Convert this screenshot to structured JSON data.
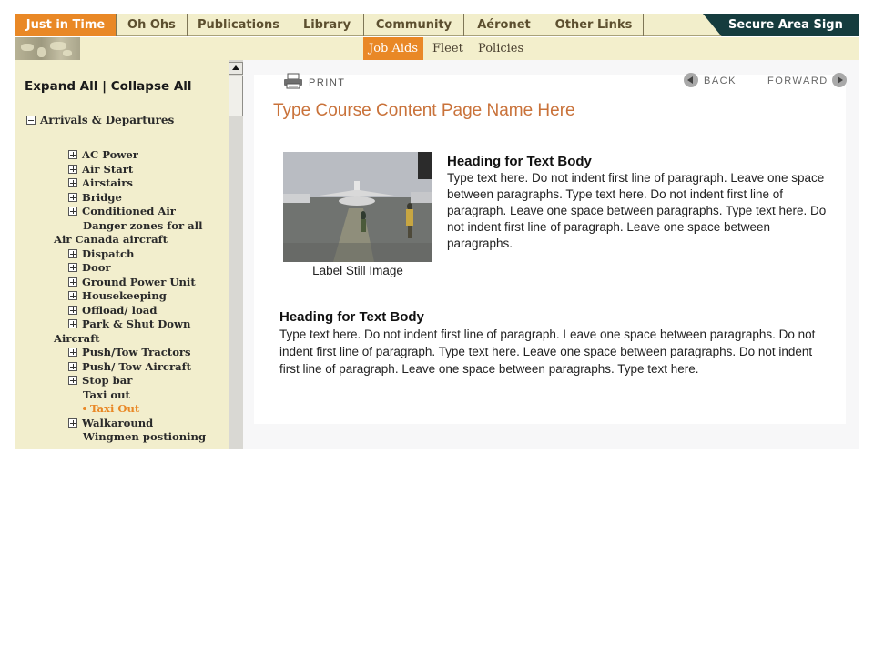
{
  "top_nav": {
    "tabs": [
      {
        "label": "Just in Time",
        "active": true
      },
      {
        "label": "Oh Ohs",
        "active": false
      },
      {
        "label": "Publications",
        "active": false
      },
      {
        "label": "Library",
        "active": false
      },
      {
        "label": "Community",
        "active": false
      },
      {
        "label": "Aéronet",
        "active": false
      },
      {
        "label": "Other Links",
        "active": false
      }
    ],
    "secure_sign_in": "Secure Area Sign In"
  },
  "sub_nav": {
    "tabs": [
      {
        "label": "Job Aids",
        "active": true
      },
      {
        "label": "Fleet",
        "active": false
      },
      {
        "label": "Policies",
        "active": false
      }
    ]
  },
  "sidebar": {
    "expand_all": "Expand All",
    "separator": "|",
    "collapse_all": "Collapse All",
    "section": "Arrivals & Departures",
    "items": [
      {
        "label": "AC Power"
      },
      {
        "label": "Air Start"
      },
      {
        "label": "Airstairs"
      },
      {
        "label": "Bridge"
      },
      {
        "label": "Conditioned Air"
      },
      {
        "label": "Danger zones for all"
      },
      {
        "label": "Air Canada aircraft"
      },
      {
        "label": "Dispatch"
      },
      {
        "label": "Door"
      },
      {
        "label": "Ground Power Unit"
      },
      {
        "label": "Housekeeping"
      },
      {
        "label": "Offload/ load"
      },
      {
        "label": "Park & Shut Down"
      },
      {
        "label": "Aircraft"
      },
      {
        "label": "Push/Tow Tractors"
      },
      {
        "label": "Push/ Tow Aircraft"
      },
      {
        "label": "Stop bar"
      },
      {
        "label": "Taxi out"
      },
      {
        "label": "Taxi Out"
      },
      {
        "label": "Walkaround"
      },
      {
        "label": "Wingmen postioning"
      }
    ]
  },
  "content": {
    "print_label": "PRINT",
    "back_label": "BACK",
    "forward_label": "FORWARD",
    "page_title": "Type Course Content Page Name Here",
    "image_caption": "Label Still Image",
    "block1": {
      "heading": "Heading for Text Body",
      "body": "Type text here. Do not indent first line of paragraph. Leave one space between paragraphs. Type text here. Do not indent first line of paragraph. Leave one space between paragraphs. Type text here. Do not indent first line of paragraph. Leave one space between paragraphs."
    },
    "block2": {
      "heading": "Heading for Text Body",
      "body": "Type text here. Do not indent first line of paragraph. Leave one space between paragraphs. Do not indent first line of paragraph. Type text here. Leave one space between paragraphs. Do not indent first line of paragraph. Leave one space between paragraphs. Type text here."
    }
  },
  "colors": {
    "accent_orange": "#e98826",
    "nav_dark_teal": "#153c3e",
    "nav_background": "#f2eecb",
    "title_orange": "#c9723a"
  }
}
